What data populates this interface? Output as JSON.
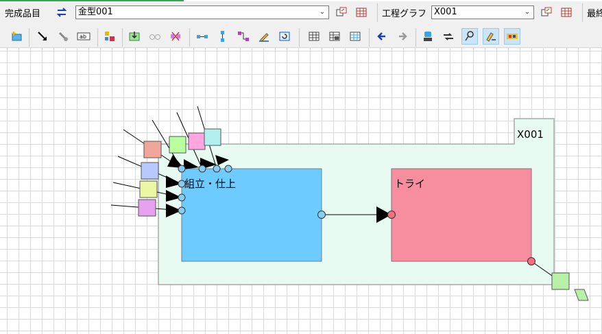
{
  "toolbar": {
    "product_label": "完成品目",
    "product_value": "金型001",
    "process_label": "工程グラフ",
    "process_value": "X001",
    "last_label": "最終"
  },
  "diagram": {
    "container_label": "X001",
    "nodes": [
      {
        "label": "組立・仕上",
        "color": "#6ecbff"
      },
      {
        "label": "トライ",
        "color": "#f78ea0"
      }
    ],
    "small_items": [
      "#f2a69b",
      "#b8ff9e",
      "#ffa6e0",
      "#b2f0f0",
      "#b8c9ff",
      "#ecf7a6",
      "#e5a0ee"
    ]
  },
  "colors": {
    "container_fill": "#e8fbf3",
    "port_blue": "#88ccf2",
    "port_red": "#f4707f",
    "output_item": "#b8f0a8"
  },
  "icons": [
    "plus-item-icon",
    "arrow-icon",
    "link-icon",
    "text-icon",
    "colors-icon",
    "import-icon",
    "glasses-icon",
    "unlink-icon",
    "h-link-icon",
    "v-link-icon",
    "step-link-icon",
    "pen-icon",
    "refresh-icon",
    "table-icon",
    "table2-icon",
    "table3-icon",
    "back-icon",
    "forward-icon",
    "stamp-icon",
    "flow-icon",
    "brush-icon",
    "marker-icon",
    "color-swap-icon"
  ]
}
